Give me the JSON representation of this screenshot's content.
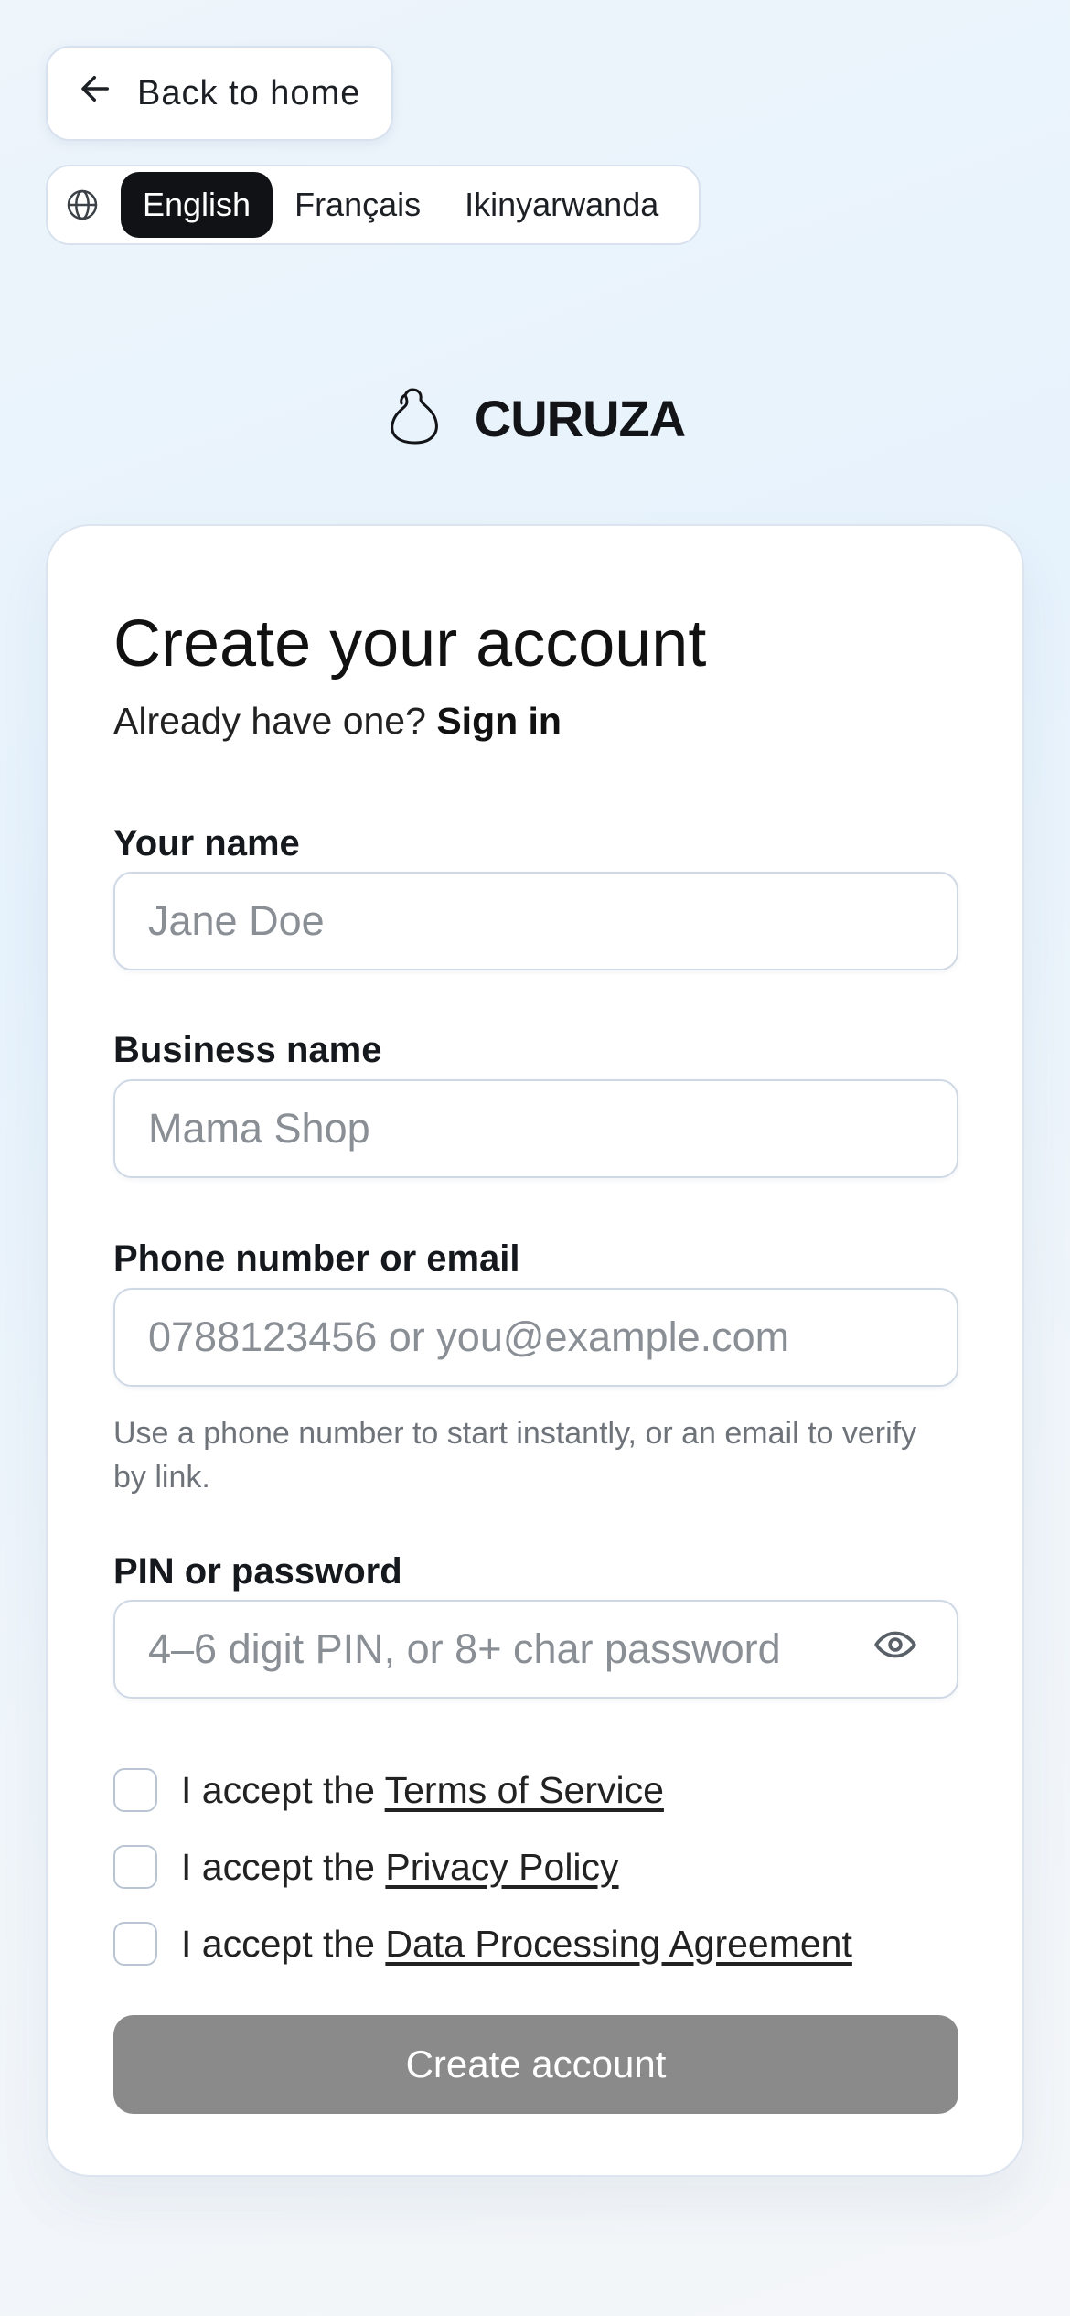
{
  "header": {
    "back_label": "Back to home",
    "languages": [
      {
        "label": "English",
        "active": true
      },
      {
        "label": "Français",
        "active": false
      },
      {
        "label": "Ikinyarwanda",
        "active": false
      }
    ]
  },
  "brand": {
    "name": "CURUZA",
    "icon": "bag-logo-icon"
  },
  "form": {
    "title": "Create your account",
    "subtitle_prefix": "Already have one?",
    "sign_in_link": "Sign in",
    "fields": {
      "name": {
        "label": "Your name",
        "placeholder": "Jane Doe",
        "value": ""
      },
      "business": {
        "label": "Business name",
        "placeholder": "Mama Shop",
        "value": ""
      },
      "contact": {
        "label": "Phone number or email",
        "placeholder": "0788123456 or you@example.com",
        "value": "",
        "hint": "Use a phone number to start instantly, or an email to verify by link."
      },
      "secret": {
        "label": "PIN or password",
        "placeholder": "4–6 digit PIN, or 8+ char password",
        "value": "",
        "icon": "eye-icon"
      }
    },
    "consents": [
      {
        "prefix": "I accept the",
        "link": "Terms of Service",
        "checked": false
      },
      {
        "prefix": "I accept the",
        "link": "Privacy Policy",
        "checked": false
      },
      {
        "prefix": "I accept the",
        "link": "Data Processing Agreement",
        "checked": false
      }
    ],
    "submit_label": "Create account"
  },
  "colors": {
    "accent_dark": "#111215",
    "button_disabled": "#8a8a8a",
    "border": "#cfd9e6"
  }
}
